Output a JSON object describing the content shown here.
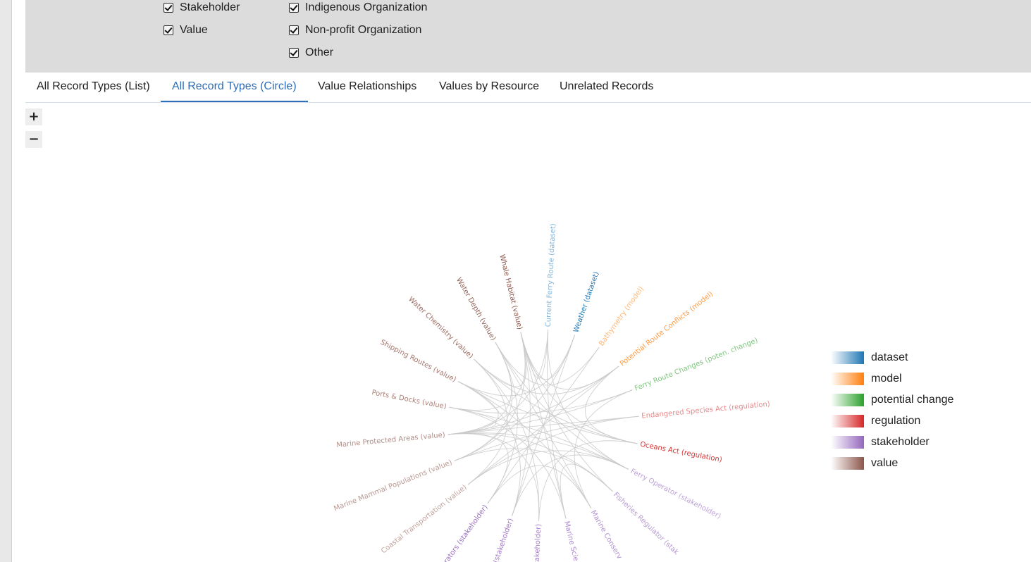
{
  "filters": {
    "col1": [
      "Stakeholder",
      "Value"
    ],
    "col2": [
      "Indigenous Organization",
      "Non-profit Organization",
      "Other"
    ]
  },
  "tabs": [
    {
      "label": "All Record Types (List)",
      "active": false
    },
    {
      "label": "All Record Types (Circle)",
      "active": true
    },
    {
      "label": "Value Relationships",
      "active": false
    },
    {
      "label": "Values by Resource",
      "active": false
    },
    {
      "label": "Unrelated Records",
      "active": false
    }
  ],
  "zoom": {
    "in": "+",
    "out": "−"
  },
  "nodes": [
    {
      "label": "Current Ferry Route (dataset)",
      "type": "dataset"
    },
    {
      "label": "Weather (dataset)",
      "type": "dataset"
    },
    {
      "label": "Bathymetry (model)",
      "type": "model"
    },
    {
      "label": "Potential Route Conflicts (model)",
      "type": "model"
    },
    {
      "label": "Ferry Route Changes (poten. change)",
      "type": "potential change"
    },
    {
      "label": "Endangered Species Act (regulation)",
      "type": "regulation"
    },
    {
      "label": "Oceans Act (regulation)",
      "type": "regulation"
    },
    {
      "label": "Ferry Operator (stakeholder)",
      "type": "stakeholder"
    },
    {
      "label": "Fisheries Regulator (stak",
      "type": "stakeholder"
    },
    {
      "label": "Marine Conserv",
      "type": "stakeholder"
    },
    {
      "label": "Marine Scie",
      "type": "stakeholder"
    },
    {
      "label": "stakeholder)",
      "type": "stakeholder"
    },
    {
      "label": "or (stakeholder)",
      "type": "stakeholder"
    },
    {
      "label": "r Operators (stakeholder)",
      "type": "stakeholder"
    },
    {
      "label": "Coastal Transportation (value)",
      "type": "value"
    },
    {
      "label": "Marine Mammal Populations (value)",
      "type": "value"
    },
    {
      "label": "Marine Protected Areas (value)",
      "type": "value"
    },
    {
      "label": "Ports & Docks (value)",
      "type": "value"
    },
    {
      "label": "Shipping Routes (value)",
      "type": "value"
    },
    {
      "label": "Water Chemistry (value)",
      "type": "value"
    },
    {
      "label": "Water Depth (value)",
      "type": "value"
    },
    {
      "label": "Whale Habitat (value)",
      "type": "value"
    }
  ],
  "links": [
    [
      21,
      0
    ],
    [
      21,
      1
    ],
    [
      21,
      3
    ],
    [
      21,
      6
    ],
    [
      21,
      8
    ],
    [
      21,
      10
    ],
    [
      21,
      12
    ],
    [
      21,
      15
    ],
    [
      21,
      17
    ],
    [
      21,
      19
    ],
    [
      16,
      0
    ],
    [
      16,
      3
    ],
    [
      16,
      4
    ],
    [
      16,
      5
    ],
    [
      16,
      7
    ],
    [
      16,
      8
    ],
    [
      16,
      11
    ],
    [
      16,
      13
    ],
    [
      16,
      17
    ],
    [
      16,
      18
    ],
    [
      16,
      20
    ],
    [
      20,
      7
    ],
    [
      20,
      9
    ],
    [
      20,
      2
    ],
    [
      20,
      13
    ],
    [
      20,
      15
    ],
    [
      19,
      3
    ],
    [
      19,
      11
    ],
    [
      19,
      14
    ],
    [
      19,
      6
    ],
    [
      18,
      6
    ],
    [
      18,
      9
    ],
    [
      18,
      12
    ],
    [
      18,
      1
    ],
    [
      17,
      4
    ],
    [
      17,
      7
    ],
    [
      17,
      10
    ],
    [
      15,
      5
    ],
    [
      15,
      1
    ],
    [
      15,
      8
    ],
    [
      14,
      3
    ],
    [
      14,
      7
    ],
    [
      0,
      7
    ],
    [
      0,
      10
    ],
    [
      1,
      12
    ],
    [
      2,
      13
    ],
    [
      3,
      6
    ],
    [
      4,
      9
    ],
    [
      5,
      14
    ],
    [
      6,
      11
    ],
    [
      12,
      7
    ],
    [
      8,
      10
    ],
    [
      9,
      13
    ]
  ],
  "legend": [
    {
      "label": "dataset",
      "color": "#1f77b4"
    },
    {
      "label": "model",
      "color": "#ff7f0e"
    },
    {
      "label": "potential change",
      "color": "#2ca02c"
    },
    {
      "label": "regulation",
      "color": "#d62728"
    },
    {
      "label": "stakeholder",
      "color": "#9467bd"
    },
    {
      "label": "value",
      "color": "#8c564b"
    }
  ]
}
